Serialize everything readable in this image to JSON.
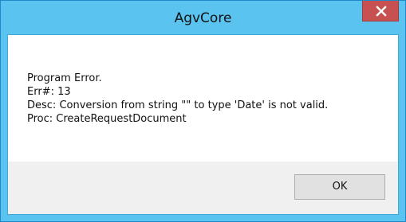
{
  "window": {
    "title": "AgvCore",
    "close_icon": "close-icon"
  },
  "message": {
    "line1": "Program Error.",
    "line2": "Err#: 13",
    "line3": "Desc: Conversion from string \"\" to type 'Date' is not valid.",
    "line4": "Proc: CreateRequestDocument"
  },
  "buttons": {
    "ok_label": "OK"
  },
  "colors": {
    "titlebar": "#5bc3ef",
    "close_button": "#c75050",
    "footer": "#f0f0f0"
  }
}
